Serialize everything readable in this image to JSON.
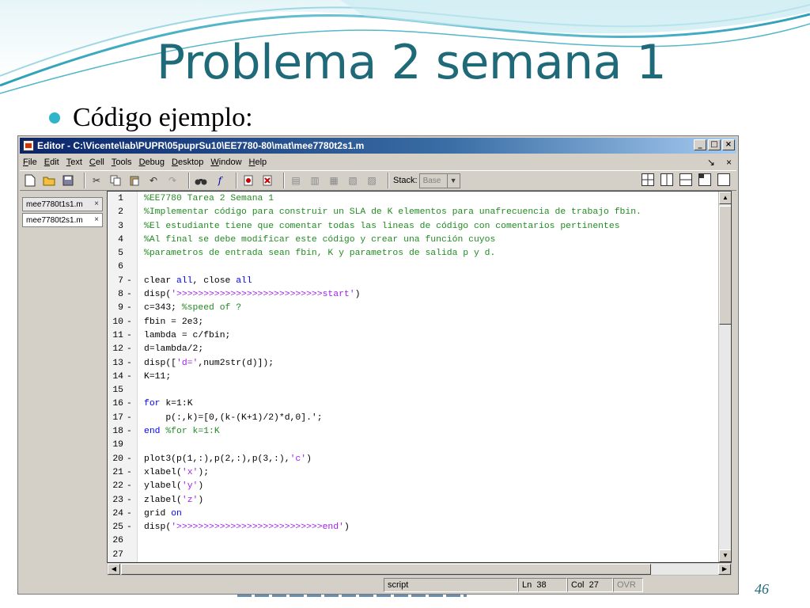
{
  "slide": {
    "title": "Problema 2 semana 1",
    "bullet": "Código ejemplo:",
    "page_number": "46"
  },
  "window": {
    "title": "Editor - C:\\Vicente\\lab\\PUPR\\05puprSu10\\EE7780-80\\mat\\mee7780t2s1.m",
    "buttons": [
      "_",
      "□",
      "×"
    ]
  },
  "menu": {
    "items": [
      "File",
      "Edit",
      "Text",
      "Cell",
      "Tools",
      "Debug",
      "Desktop",
      "Window",
      "Help"
    ],
    "right_icons": [
      "↘",
      "×"
    ]
  },
  "toolbar": {
    "stack_label": "Stack:",
    "stack_value": "Base"
  },
  "files": [
    {
      "name": "mee7780t1s1.m",
      "close": "×"
    },
    {
      "name": "mee7780t2s1.m",
      "close": "×"
    }
  ],
  "code": [
    {
      "n": "1",
      "dash": "",
      "segs": [
        {
          "t": "%EE7780 Tarea 2 Semana 1",
          "c": "cmt"
        }
      ]
    },
    {
      "n": "2",
      "dash": "",
      "segs": [
        {
          "t": "%Implementar código para construir un SLA de K elementos para unafrecuencia de trabajo fbin.",
          "c": "cmt"
        }
      ]
    },
    {
      "n": "3",
      "dash": "",
      "segs": [
        {
          "t": "%El estudiante tiene que comentar todas las lineas de código con comentarios pertinentes",
          "c": "cmt"
        }
      ]
    },
    {
      "n": "4",
      "dash": "",
      "segs": [
        {
          "t": "%Al final se debe modificar este código y crear una función cuyos",
          "c": "cmt"
        }
      ]
    },
    {
      "n": "5",
      "dash": "",
      "segs": [
        {
          "t": "%parametros de entrada sean fbin, K y parametros de salida p y d.",
          "c": "cmt"
        }
      ]
    },
    {
      "n": "6",
      "dash": "",
      "segs": []
    },
    {
      "n": "7",
      "dash": "-",
      "segs": [
        {
          "t": "clear ",
          "c": "txt"
        },
        {
          "t": "all",
          "c": "kw"
        },
        {
          "t": ", close ",
          "c": "txt"
        },
        {
          "t": "all",
          "c": "kw"
        }
      ]
    },
    {
      "n": "8",
      "dash": "-",
      "segs": [
        {
          "t": "disp(",
          "c": "txt"
        },
        {
          "t": "'>>>>>>>>>>>>>>>>>>>>>>>>>>>start'",
          "c": "str"
        },
        {
          "t": ")",
          "c": "txt"
        }
      ]
    },
    {
      "n": "9",
      "dash": "-",
      "segs": [
        {
          "t": "c=343; ",
          "c": "txt"
        },
        {
          "t": "%speed of ?",
          "c": "cmt"
        }
      ]
    },
    {
      "n": "10",
      "dash": "-",
      "segs": [
        {
          "t": "fbin = 2e3;",
          "c": "txt"
        }
      ]
    },
    {
      "n": "11",
      "dash": "-",
      "segs": [
        {
          "t": "lambda = c/fbin;",
          "c": "txt"
        }
      ]
    },
    {
      "n": "12",
      "dash": "-",
      "segs": [
        {
          "t": "d=lambda/2;",
          "c": "txt"
        }
      ]
    },
    {
      "n": "13",
      "dash": "-",
      "segs": [
        {
          "t": "disp([",
          "c": "txt"
        },
        {
          "t": "'d='",
          "c": "str"
        },
        {
          "t": ",num2str(d)]);",
          "c": "txt"
        }
      ]
    },
    {
      "n": "14",
      "dash": "-",
      "segs": [
        {
          "t": "K=11;",
          "c": "txt"
        }
      ]
    },
    {
      "n": "15",
      "dash": "",
      "segs": []
    },
    {
      "n": "16",
      "dash": "-",
      "segs": [
        {
          "t": "for",
          "c": "kw"
        },
        {
          "t": " k=1:K",
          "c": "txt"
        }
      ]
    },
    {
      "n": "17",
      "dash": "-",
      "segs": [
        {
          "t": "    p(:,k)=[0,(k-(K+1)/2)*d,0].';",
          "c": "txt"
        }
      ]
    },
    {
      "n": "18",
      "dash": "-",
      "segs": [
        {
          "t": "end",
          "c": "kw"
        },
        {
          "t": " %for k=1:K",
          "c": "cmt"
        }
      ]
    },
    {
      "n": "19",
      "dash": "",
      "segs": []
    },
    {
      "n": "20",
      "dash": "-",
      "segs": [
        {
          "t": "plot3(p(1,:),p(2,:),p(3,:),",
          "c": "txt"
        },
        {
          "t": "'c'",
          "c": "str"
        },
        {
          "t": ")",
          "c": "txt"
        }
      ]
    },
    {
      "n": "21",
      "dash": "-",
      "segs": [
        {
          "t": "xlabel(",
          "c": "txt"
        },
        {
          "t": "'x'",
          "c": "str"
        },
        {
          "t": ");",
          "c": "txt"
        }
      ]
    },
    {
      "n": "22",
      "dash": "-",
      "segs": [
        {
          "t": "ylabel(",
          "c": "txt"
        },
        {
          "t": "'y'",
          "c": "str"
        },
        {
          "t": ")",
          "c": "txt"
        }
      ]
    },
    {
      "n": "23",
      "dash": "-",
      "segs": [
        {
          "t": "zlabel(",
          "c": "txt"
        },
        {
          "t": "'z'",
          "c": "str"
        },
        {
          "t": ")",
          "c": "txt"
        }
      ]
    },
    {
      "n": "24",
      "dash": "-",
      "segs": [
        {
          "t": "grid ",
          "c": "txt"
        },
        {
          "t": "on",
          "c": "kw"
        }
      ]
    },
    {
      "n": "25",
      "dash": "-",
      "segs": [
        {
          "t": "disp(",
          "c": "txt"
        },
        {
          "t": "'>>>>>>>>>>>>>>>>>>>>>>>>>>>end'",
          "c": "str"
        },
        {
          "t": ")",
          "c": "txt"
        }
      ]
    },
    {
      "n": "26",
      "dash": "",
      "segs": []
    },
    {
      "n": "27",
      "dash": "",
      "segs": []
    }
  ],
  "status": {
    "mode": "script",
    "ln_label": "Ln",
    "ln": "38",
    "col_label": "Col",
    "col": "27",
    "ovr": "OVR"
  },
  "colors": {
    "title": "#1f6a78",
    "bullet": "#2fb4c9",
    "comment": "#228b22",
    "keyword": "#0000ff",
    "string": "#a020f0"
  }
}
